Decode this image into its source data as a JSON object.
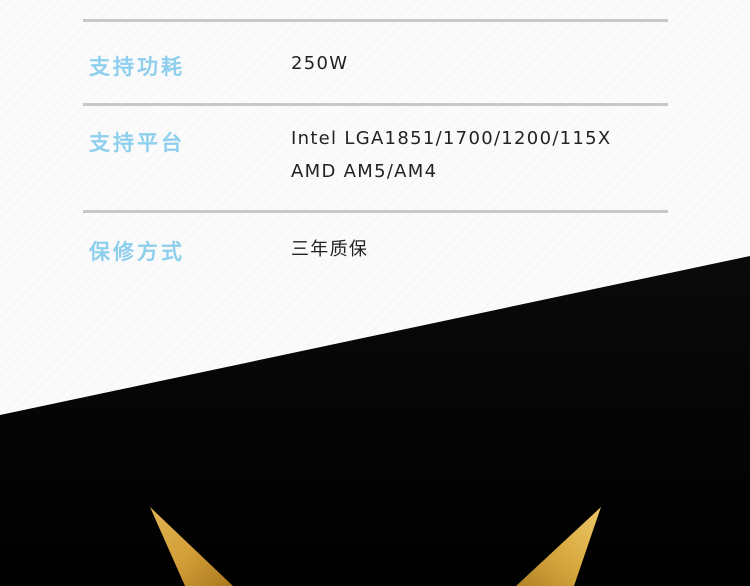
{
  "specs": [
    {
      "label": "支持功耗",
      "value_lines": [
        "250W"
      ]
    },
    {
      "label": "支持平台",
      "value_lines": [
        "Intel LGA1851/1700/1200/115X",
        "AMD AM5/AM4"
      ]
    },
    {
      "label": "保修方式",
      "value_lines": [
        "三年质保"
      ]
    }
  ],
  "colors": {
    "label": "#8ecfee",
    "value_text": "#222222",
    "divider": "#c8c8c8",
    "dark_banner": "#000000",
    "gold": "#d9a83c"
  },
  "decor": {
    "banner_graphic": "gold-v-wings-icon"
  }
}
